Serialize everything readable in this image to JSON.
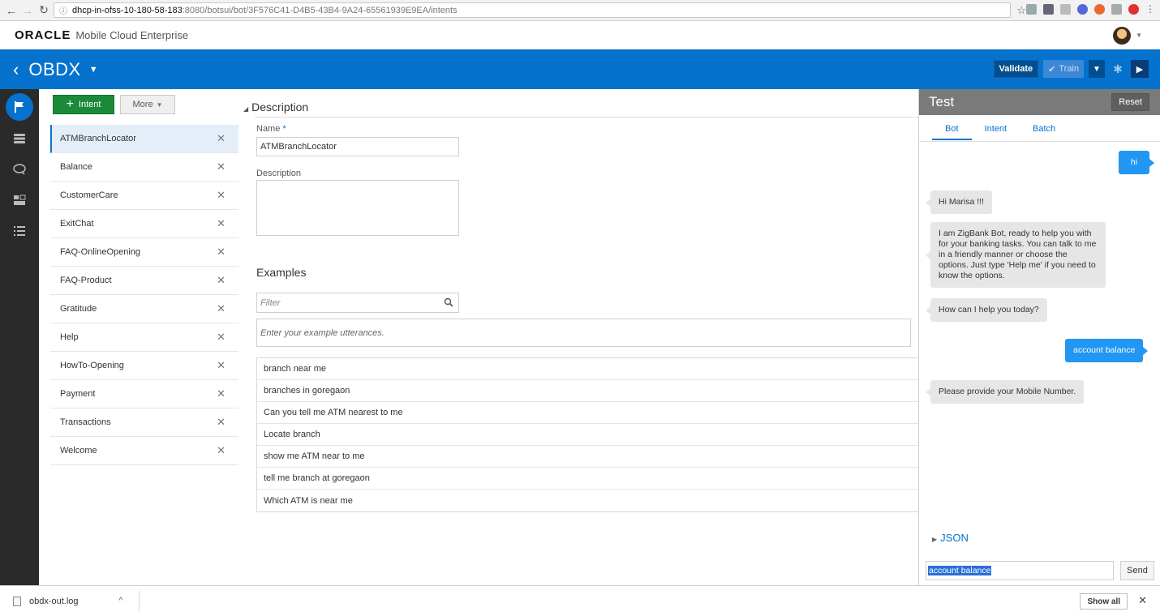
{
  "browser": {
    "url_host": "dhcp-in-ofss-10-180-58-183",
    "url_path": ":8080/botsui/bot/3F576C41-D4B5-43B4-9A24-65561939E9EA/intents"
  },
  "brand": {
    "logo": "ORACLE",
    "product": "Mobile Cloud Enterprise"
  },
  "botbar": {
    "bot_name": "OBDX",
    "validate": "Validate",
    "train": "Train"
  },
  "intents": {
    "add_label": "Intent",
    "more_label": "More",
    "items": [
      {
        "label": "ATMBranchLocator"
      },
      {
        "label": "Balance"
      },
      {
        "label": "CustomerCare"
      },
      {
        "label": "ExitChat"
      },
      {
        "label": "FAQ-OnlineOpening"
      },
      {
        "label": "FAQ-Product"
      },
      {
        "label": "Gratitude"
      },
      {
        "label": "Help"
      },
      {
        "label": "HowTo-Opening"
      },
      {
        "label": "Payment"
      },
      {
        "label": "Transactions"
      },
      {
        "label": "Welcome"
      }
    ]
  },
  "editor": {
    "section_title": "Description",
    "name_label": "Name",
    "required_mark": "*",
    "name_value": "ATMBranchLocator",
    "description_label": "Description",
    "examples_title": "Examples",
    "filter_placeholder": "Filter",
    "utterance_placeholder": "Enter your example utterances.",
    "examples": [
      "branch near me",
      "branches in goregaon",
      "Can you tell me ATM nearest to me",
      "Locate branch",
      "show me ATM near to me",
      "tell me branch at goregaon",
      "Which ATM is near me"
    ]
  },
  "test": {
    "title": "Test",
    "reset": "Reset",
    "tabs": [
      "Bot",
      "Intent",
      "Batch"
    ],
    "messages": [
      {
        "from": "user",
        "text": "hi"
      },
      {
        "from": "bot",
        "text": "Hi Marisa !!!"
      },
      {
        "from": "bot",
        "text": "I am ZigBank Bot, ready to help you with for your banking tasks. You can talk to me in a friendly manner or choose the options. Just type 'Help me' if you need to know the options."
      },
      {
        "from": "bot",
        "text": "How can I help you today?"
      },
      {
        "from": "user",
        "text": "account balance"
      },
      {
        "from": "bot",
        "text": "Please provide your Mobile Number."
      }
    ],
    "json_label": "JSON",
    "input_value": "account balance",
    "send": "Send"
  },
  "downloads": {
    "file_name": "obdx-out.log",
    "show_all": "Show all"
  },
  "colors": {
    "accent": "#0572ce",
    "intent_button": "#1a8a3a",
    "user_bubble": "#2196f3",
    "rail": "#2a2a2a"
  }
}
